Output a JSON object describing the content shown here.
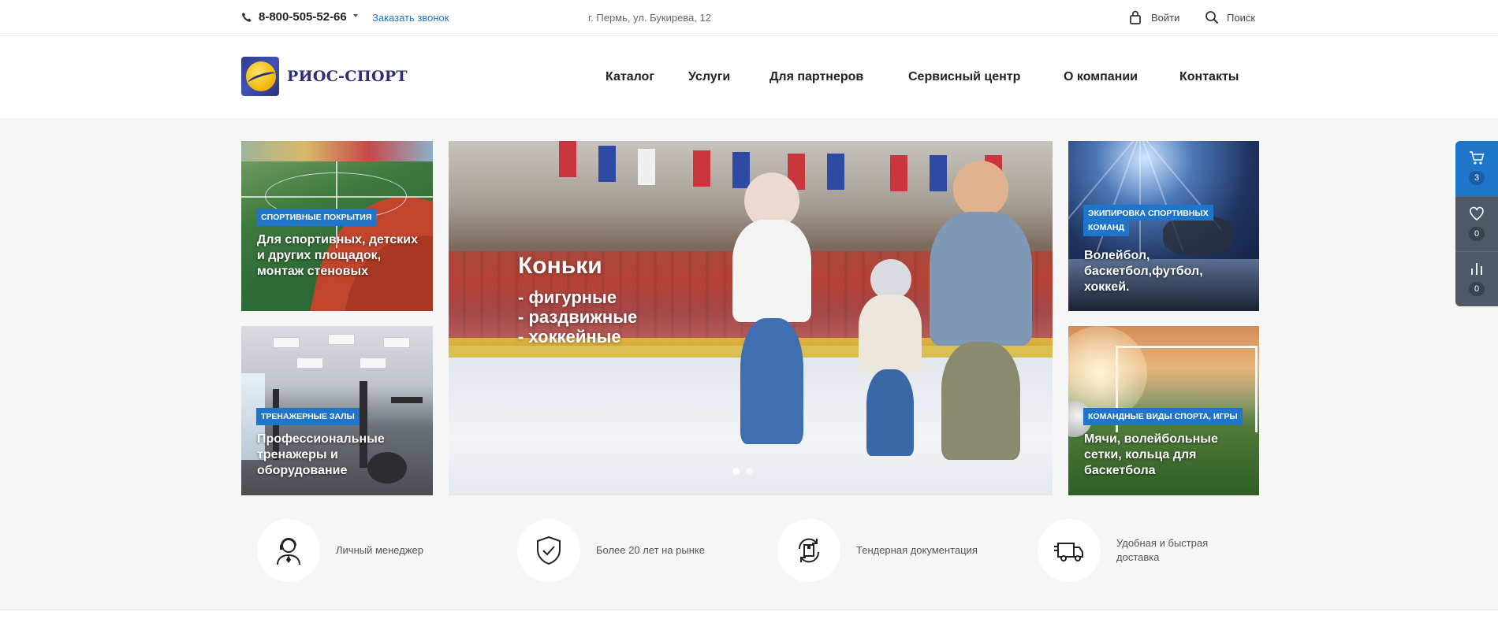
{
  "topbar": {
    "phone": "8-800-505-52-66",
    "callback_label": "Заказать звонок",
    "address": "г. Пермь, ул. Букирева, 12",
    "login_label": "Войти",
    "search_label": "Поиск"
  },
  "header": {
    "logo_text": "РИОС-СПОРТ",
    "nav": [
      "Каталог",
      "Услуги",
      "Для партнеров",
      "Сервисный центр",
      "О компании",
      "Контакты"
    ]
  },
  "tiles": {
    "coverings": {
      "badge": "СПОРТИВНЫЕ ПОКРЫТИЯ",
      "text": "Для спортивных, детских и других площадок, монтаж стеновых"
    },
    "gyms": {
      "badge": "ТРЕНАЖЕРНЫЕ ЗАЛЫ",
      "text": "Профессиональные тренажеры и оборудование"
    },
    "equipment": {
      "badge_line1": "ЭКИПИРОВКА СПОРТИВНЫХ",
      "badge_line2": "КОМАНД",
      "text": "Волейбол, баскетбол,футбол, хоккей."
    },
    "team_sports": {
      "badge": "КОМАНДНЫЕ ВИДЫ СПОРТА, ИГРЫ",
      "text": "Мячи, волейбольные сетки, кольца для баскетбола"
    }
  },
  "slider": {
    "title": "Коньки",
    "lines": [
      "- фигурные",
      "- раздвижные",
      "- хоккейные"
    ],
    "slide_count": 2,
    "active_slide": 1
  },
  "features": [
    {
      "icon": "manager-icon",
      "text": "Личный менеджер"
    },
    {
      "icon": "shield-check-icon",
      "text": "Более 20 лет на рынке"
    },
    {
      "icon": "document-cycle-icon",
      "text": "Тендерная документация"
    },
    {
      "icon": "truck-icon",
      "text_line1": "Удобная и быстрая",
      "text_line2": "доставка"
    }
  ],
  "side_panel": {
    "cart_count": "3",
    "favorites_count": "0",
    "compare_count": "0"
  },
  "colors": {
    "accent": "#1f75c9",
    "side_panel": "#4e5867",
    "logo_text": "#2e2f78"
  }
}
